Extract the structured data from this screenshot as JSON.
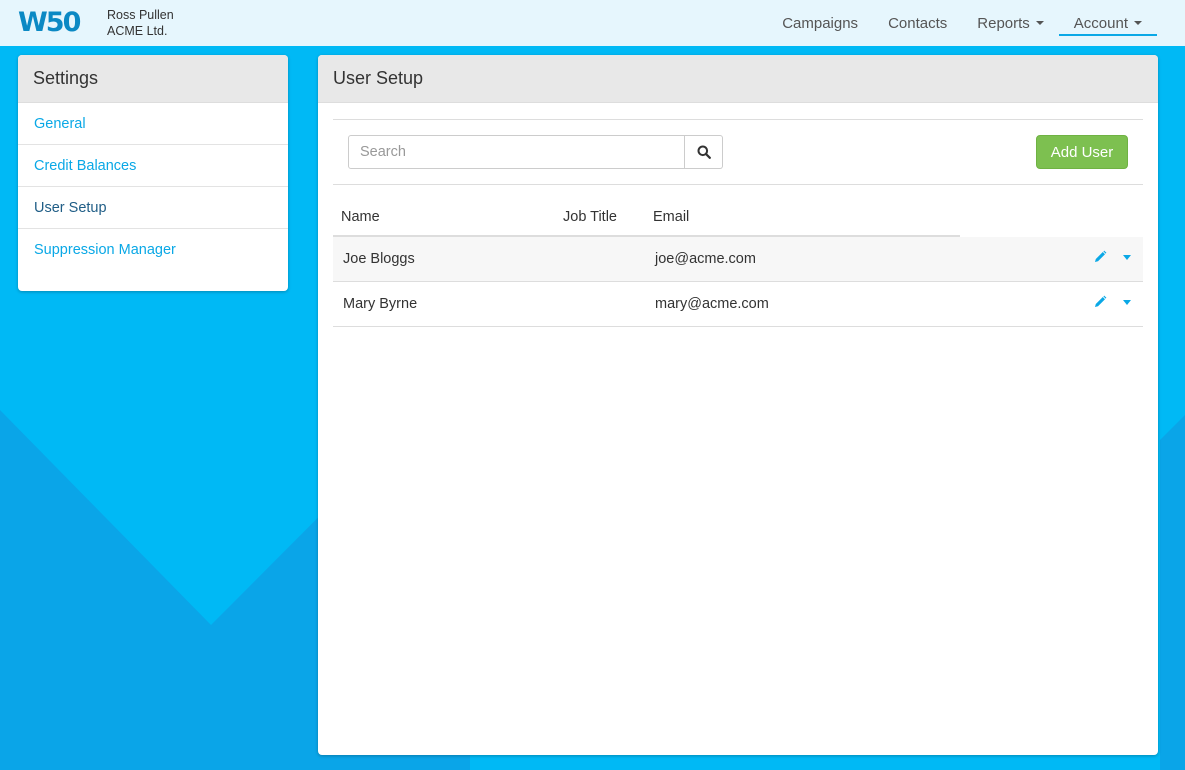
{
  "header": {
    "logo_text": "W50",
    "user_name": "Ross Pullen",
    "company": "ACME Ltd.",
    "nav": [
      {
        "label": "Campaigns"
      },
      {
        "label": "Contacts"
      },
      {
        "label": "Reports"
      },
      {
        "label": "Account"
      }
    ]
  },
  "sidebar": {
    "title": "Settings",
    "items": [
      {
        "label": "General"
      },
      {
        "label": "Credit Balances"
      },
      {
        "label": "User Setup"
      },
      {
        "label": "Suppression Manager"
      }
    ]
  },
  "main": {
    "title": "User Setup",
    "search": {
      "placeholder": "Search",
      "value": ""
    },
    "add_button": "Add User",
    "columns": [
      "Name",
      "Job Title",
      "Email"
    ],
    "rows": [
      {
        "name": "Joe Bloggs",
        "job_title": "",
        "email": "joe@acme.com"
      },
      {
        "name": "Mary Byrne",
        "job_title": "",
        "email": "mary@acme.com"
      }
    ]
  },
  "colors": {
    "accent": "#0aa8e6",
    "background": "#00b9f5",
    "add_button": "#7dc050",
    "logo": "#0b89c4"
  }
}
